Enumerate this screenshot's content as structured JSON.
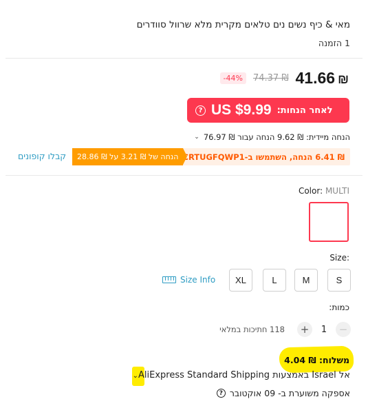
{
  "product": {
    "title": "מאי & כיף נשים נים טלאים מקרית מלא שרוול סוודרים",
    "orders": "1 הזמנה"
  },
  "price": {
    "current": "41.66",
    "currency": "₪",
    "original": "74.37 ₪",
    "discount_badge": "-44%",
    "after_discount_label": "לאחר הנחות:",
    "after_discount_amount": "US $9.99",
    "instant_discount": "הנחה מיידית: ₪ 9.62 הנחה עבור ₪ 76.97"
  },
  "coupons": {
    "code_offer": "₪ 6.41 הנחה, השתמשו ב-SACRTUGFQWP1",
    "store_offer": "הנחה של ₪ 3.21 על ₪ 28.86",
    "get_coupons": "קבלו קופונים"
  },
  "color": {
    "label": "Color:",
    "value": "MULTI"
  },
  "size": {
    "label": "Size:",
    "options": [
      "S",
      "M",
      "L",
      "XL"
    ],
    "size_info": "Size Info"
  },
  "quantity": {
    "label": "כמות:",
    "value": "1",
    "plus": "+",
    "minus": "−",
    "stock": "118 חתיכות במלאי"
  },
  "shipping": {
    "title": "משלוח: ₪ 4.04",
    "method": "אל Israel באמצעות AliExpress Standard Shipping",
    "delivery": "אספקה משוערת ב- 09 אוקטובר"
  },
  "colors": {
    "accent": "#fd384f",
    "coupon_orange": "#ff9c00",
    "link": "#2e9cc3",
    "highlight": "#ffec00"
  }
}
